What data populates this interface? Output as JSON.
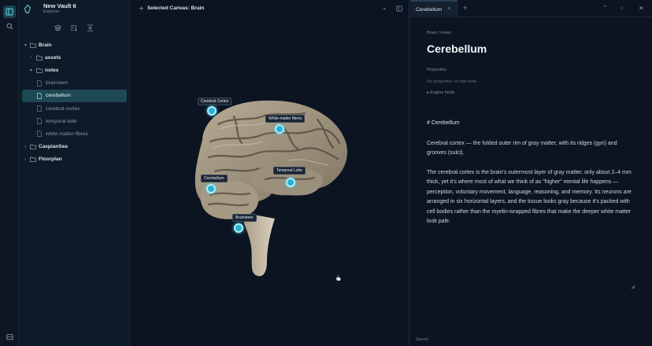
{
  "app": {
    "vault_name": "New Vault 6",
    "vault_sub": "Explorer"
  },
  "sidebar": {
    "tree": [
      {
        "label": "Brain",
        "kind": "folder",
        "level": 0,
        "expanded": true
      },
      {
        "label": "assets",
        "kind": "folder",
        "level": 1,
        "expanded": false
      },
      {
        "label": "notes",
        "kind": "folder",
        "level": 1,
        "expanded": true
      },
      {
        "label": "brainstem",
        "kind": "file",
        "level": 2
      },
      {
        "label": "cerebellum",
        "kind": "file",
        "level": 2,
        "selected": true
      },
      {
        "label": "cerebral-cortex",
        "kind": "file",
        "level": 2
      },
      {
        "label": "temporal-lobe",
        "kind": "file",
        "level": 2
      },
      {
        "label": "white-matter-fibres",
        "kind": "file",
        "level": 2
      },
      {
        "label": "CaspianSea",
        "kind": "folder",
        "level": 0,
        "expanded": false
      },
      {
        "label": "Floorplan",
        "kind": "folder",
        "level": 0,
        "expanded": false
      }
    ]
  },
  "canvas": {
    "title": "Selected Canvas: Brain",
    "pins": [
      "Cerebral Cortex",
      "White-matter fibres",
      "Temporal Lobe",
      "Cerebellum",
      "Brainstem"
    ]
  },
  "note": {
    "tab_label": "Cerebellum",
    "breadcrumb": "Brain / notes",
    "title": "Cerebellum",
    "properties_label": "Properties",
    "properties_empty": "No properties on this note.",
    "engine_label": "Engine fields",
    "md_heading": "# Cerebellum",
    "para1": "Cerebral cortex — the folded outer rim of gray matter, with its ridges (gyri) and grooves (sulci).",
    "para2": "The cerebral cortex is the brain's outermost layer of gray matter, only about 2–4 mm thick, yet it's where most of what we think of as \"higher\" mental life happens — perception, voluntary movement, language, reasoning, and memory. Its neurons are arranged in six horizontal layers, and the tissue looks gray because it's packed with cell bodies rather than the myelin-wrapped fibres that make the deeper white matter look pale.",
    "status": "Saved"
  },
  "colors": {
    "accent": "#24b4d8",
    "selection": "#1d4854",
    "background": "#0c1421"
  }
}
